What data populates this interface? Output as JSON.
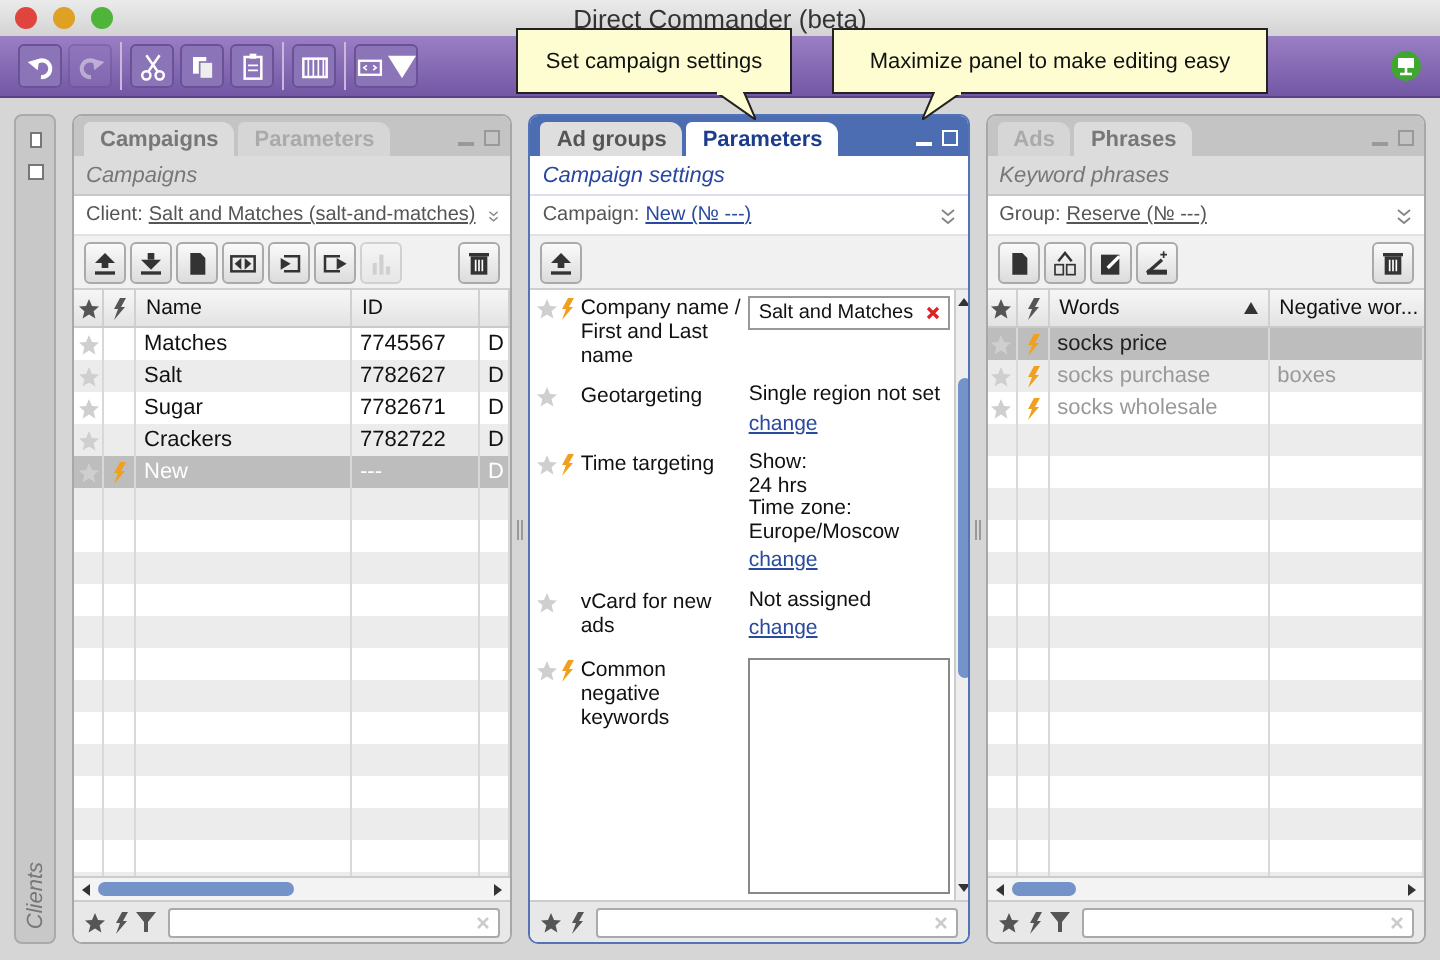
{
  "window": {
    "title": "Direct Commander (beta)"
  },
  "toolbar": [
    {
      "kind": "undo",
      "disabled": false
    },
    {
      "kind": "redo",
      "disabled": true
    },
    {
      "kind": "cut",
      "disabled": false
    },
    {
      "kind": "copy",
      "disabled": false
    },
    {
      "kind": "paste",
      "disabled": false
    },
    {
      "kind": "columns",
      "disabled": false
    },
    {
      "kind": "view",
      "disabled": false
    }
  ],
  "sidebar": {
    "label": "Clients"
  },
  "panels": [
    {
      "active": false,
      "tabs": [
        {
          "label": "Campaigns",
          "selected": true
        },
        {
          "label": "Parameters",
          "selected": false
        }
      ],
      "subtitle": "Campaigns",
      "context": {
        "label": "Client:",
        "link": "Salt and Matches (salt-and-matches)"
      },
      "tools": [
        {
          "kind": "upload",
          "disabled": false
        },
        {
          "kind": "download",
          "disabled": false
        },
        {
          "kind": "document",
          "disabled": false
        },
        {
          "kind": "swap",
          "disabled": false
        },
        {
          "kind": "import",
          "disabled": false
        },
        {
          "kind": "export",
          "disabled": false
        },
        {
          "kind": "stats",
          "disabled": true
        }
      ],
      "table": {
        "columns": [
          {
            "label": "Name",
            "sorted": false
          },
          {
            "label": "ID",
            "sorted": false
          }
        ],
        "rows": [
          {
            "starred": false,
            "flagged": false,
            "selected": false,
            "dimmed": false,
            "cells": [
              "Matches",
              "7745567",
              "D"
            ]
          },
          {
            "starred": false,
            "flagged": false,
            "selected": false,
            "dimmed": false,
            "cells": [
              "Salt",
              "7782627",
              "D"
            ]
          },
          {
            "starred": false,
            "flagged": false,
            "selected": false,
            "dimmed": false,
            "cells": [
              "Sugar",
              "7782671",
              "D"
            ]
          },
          {
            "starred": false,
            "flagged": false,
            "selected": false,
            "dimmed": false,
            "cells": [
              "Crackers",
              "7782722",
              "D"
            ]
          },
          {
            "starred": false,
            "flagged": true,
            "selected": true,
            "dimmed": false,
            "cells": [
              "New",
              "---",
              "D"
            ]
          }
        ]
      },
      "footer": {
        "filter": true
      }
    },
    {
      "active": true,
      "tabs": [
        {
          "label": "Ad groups",
          "selected": false
        },
        {
          "label": "Parameters",
          "selected": true
        }
      ],
      "subtitle": "Campaign settings",
      "context": {
        "label": "Campaign:",
        "link": "New (№ ---)"
      },
      "tools": [
        {
          "kind": "upload",
          "disabled": false
        }
      ],
      "form": [
        {
          "kind": "input",
          "label": "Company name / First and Last name",
          "starred": false,
          "flagged": true,
          "value": "Salt and Matches"
        },
        {
          "kind": "info",
          "label": "Geotargeting",
          "starred": false,
          "flagged": false,
          "lines": [
            "Single region not set"
          ],
          "link": "change"
        },
        {
          "kind": "info",
          "label": "Time targeting",
          "starred": false,
          "flagged": true,
          "lines": [
            "Show:",
            "24 hrs",
            "Time zone:",
            "Europe/Moscow"
          ],
          "link": "change"
        },
        {
          "kind": "info",
          "label": "vCard for new ads",
          "starred": false,
          "flagged": false,
          "lines": [
            "Not assigned"
          ],
          "link": "change"
        },
        {
          "kind": "textarea",
          "label": "Common negative keywords",
          "starred": false,
          "flagged": true
        }
      ],
      "footer": {
        "filter": false
      }
    },
    {
      "active": false,
      "tabs": [
        {
          "label": "Ads",
          "selected": false
        },
        {
          "label": "Phrases",
          "selected": true
        }
      ],
      "subtitle": "Keyword phrases",
      "context": {
        "label": "Group:",
        "link": "Reserve (№ ---)"
      },
      "tools": [
        {
          "kind": "document",
          "disabled": false
        },
        {
          "kind": "group",
          "disabled": false
        },
        {
          "kind": "edit",
          "disabled": false
        },
        {
          "kind": "wand",
          "disabled": false
        }
      ],
      "table": {
        "columns": [
          {
            "label": "Words",
            "sorted": true
          },
          {
            "label": "Negative wor...",
            "sorted": false
          }
        ],
        "rows": [
          {
            "starred": false,
            "flagged": true,
            "selected": true,
            "dimmed": false,
            "cells": [
              "socks price"
            ]
          },
          {
            "starred": false,
            "flagged": true,
            "selected": false,
            "dimmed": true,
            "cells": [
              "socks purchase",
              "boxes"
            ]
          },
          {
            "starred": false,
            "flagged": true,
            "selected": false,
            "dimmed": true,
            "cells": [
              "socks wholesale"
            ]
          }
        ]
      },
      "footer": {
        "filter": true
      }
    }
  ],
  "tooltips": [
    {
      "text": "Set campaign settings"
    },
    {
      "text": "Maximize panel to make editing easy"
    }
  ]
}
